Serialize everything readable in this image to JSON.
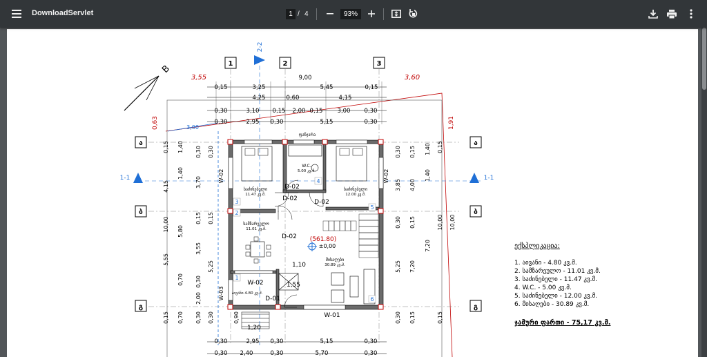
{
  "toolbar": {
    "title": "DownloadServlet",
    "page_current": "1",
    "page_separator": "/",
    "page_total": "4",
    "zoom": "93%"
  },
  "drawing": {
    "axes_top": [
      "1",
      "2",
      "3"
    ],
    "axes_side": [
      "ა",
      "ბ",
      "გ"
    ],
    "section_1": "1-1",
    "section_2": "2-2",
    "north": "B",
    "red_dims": {
      "left": "3,55",
      "right": "3,60",
      "slope_l": "0,63",
      "slope_r": "1,91"
    },
    "blue_dim": "3,00",
    "top_dims": {
      "row1": [
        "0,15",
        "3,25",
        "5,45",
        "0,15"
      ],
      "row1_total": "9,00",
      "row2": [
        "4,25",
        "0,60",
        "4,15"
      ],
      "row3": [
        "0,30",
        "3,10",
        "0,15",
        "2,00",
        "0,15",
        "3,00",
        "0,30"
      ],
      "row4": [
        "0,30",
        "2,95",
        "0,30",
        "5,15",
        "0,30"
      ]
    },
    "bottom_dims": {
      "row1": [
        "0,30",
        "2,95",
        "0,30",
        "5,15",
        "0,30"
      ],
      "row2": [
        "0,30",
        "2,40",
        "0,30",
        "5,70",
        "0,30"
      ]
    },
    "left_dims": {
      "c1": [
        "0,15",
        "4,15",
        "10,00",
        "5,55",
        "0,15"
      ],
      "c2": [
        "1,40",
        "1,40",
        "5,80",
        "0,70",
        "0,70"
      ],
      "c3": [
        "0,30",
        "3,70",
        "0,15",
        "3,55",
        "0,30",
        "2,00",
        "0,30"
      ],
      "c4": [
        "0,30",
        "0,15",
        "5,25",
        "0,30"
      ]
    },
    "right_dims": {
      "c1": [
        "0,30",
        "3,85",
        "0,30",
        "5,25",
        "0,30"
      ],
      "c2": [
        "0,15",
        "4,00",
        "0,15",
        "7,20",
        "0,15"
      ],
      "c3": [
        "1,40",
        "1,40"
      ],
      "c4": [
        "0,15",
        "10,00",
        "0,15"
      ]
    },
    "rooms": [
      {
        "name": "საძინებელი",
        "area": "11.47 კვ.მ."
      },
      {
        "name": "W.C.",
        "area": "5.00 კვ.მ."
      },
      {
        "name": "საძინებელი",
        "area": "12.00 კვ.მ."
      },
      {
        "name": "სამზარეულო",
        "area": "11.01 კვ.მ."
      },
      {
        "name": "მისაღები",
        "area": "30.89 კვ.მ."
      },
      {
        "name": "აივანი",
        "area": "4.80 კვ.მ."
      }
    ],
    "room_numbers": [
      "1",
      "2",
      "3",
      "4",
      "5",
      "6"
    ],
    "doors": [
      "D-02",
      "D-02",
      "D-02",
      "D-02",
      "D-01"
    ],
    "windows": [
      "W-02",
      "W-02",
      "W-02",
      "W-03",
      "W-01"
    ],
    "window_top_label": "ფანჯარა",
    "level": "(561.80)",
    "level_zero": "±0,00",
    "misc_dims": [
      "1,10",
      "1,55",
      "0,90",
      "1,20"
    ]
  },
  "legend": {
    "title": "ექსპლიკაცია:",
    "items": [
      "1. აივანი - 4.80 კვ.მ.",
      "2. სამზარეულო - 11.01 კვ.მ.",
      "3. საძინებელი - 11.47 კვ.მ.",
      "4. W.C. - 5.00 კვ.მ.",
      "5. საძინებელი - 12.00 კვ.მ.",
      "6. მისაღები - 30.89 კვ.მ."
    ],
    "total": "ჯამური ფართი - 75,17 კვ.მ."
  },
  "colors": {
    "toolbar": "#323639",
    "viewer": "#525659",
    "red": "#c00000",
    "blue": "#1f6fd6"
  }
}
